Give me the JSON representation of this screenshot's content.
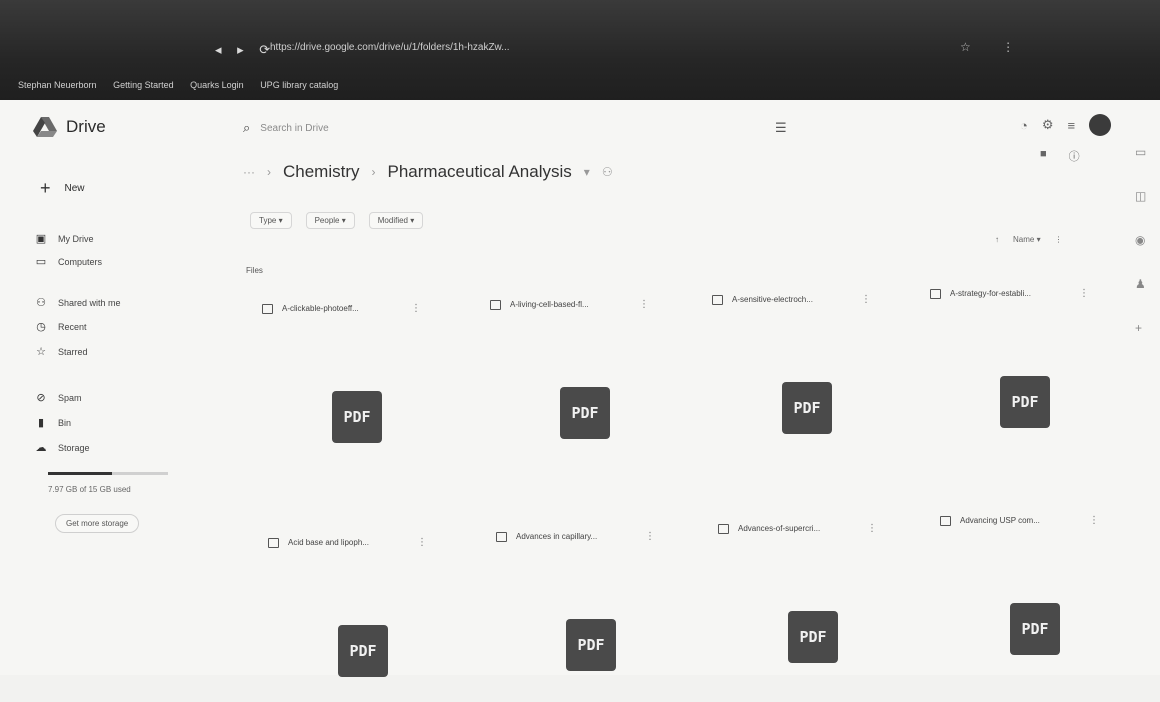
{
  "browser": {
    "url": "https://drive.google.com/drive/u/1/folders/1h-hzakZw...",
    "bookmarks": [
      "Stephan Neuerborn",
      "Getting Started",
      "Quarks Login",
      "UPG library catalog"
    ]
  },
  "app": {
    "name": "Drive"
  },
  "search": {
    "placeholder": "Search in Drive"
  },
  "sidebar": {
    "new_label": "New",
    "items": [
      {
        "label": "My Drive",
        "icon": "drive-icon"
      },
      {
        "label": "Computers",
        "icon": "computer-icon"
      },
      {
        "label": "Shared with me",
        "icon": "people-icon"
      },
      {
        "label": "Recent",
        "icon": "clock-icon"
      },
      {
        "label": "Starred",
        "icon": "star-icon"
      },
      {
        "label": "Spam",
        "icon": "spam-icon"
      },
      {
        "label": "Bin",
        "icon": "trash-icon"
      },
      {
        "label": "Storage",
        "icon": "cloud-icon"
      }
    ],
    "storage_text": "7.97 GB of 15 GB used",
    "storage_fraction": 0.53,
    "storage_button": "Get more storage"
  },
  "breadcrumb": {
    "more": "···",
    "parent": "Chemistry",
    "current": "Pharmaceutical Analysis"
  },
  "filters": [
    "Type",
    "People",
    "Modified"
  ],
  "sort_label": "Name",
  "files_label": "Files",
  "files": [
    {
      "name": "A-clickable-photoeff...",
      "type": "PDF"
    },
    {
      "name": "A-living-cell-based-fl...",
      "type": "PDF"
    },
    {
      "name": "A-sensitive-electroch...",
      "type": "PDF"
    },
    {
      "name": "A-strategy-for-establi...",
      "type": "PDF"
    },
    {
      "name": "Acid base and lipoph...",
      "type": "PDF"
    },
    {
      "name": "Advances in capillary...",
      "type": "PDF"
    },
    {
      "name": "Advances-of-supercri...",
      "type": "PDF"
    },
    {
      "name": "Advancing USP com...",
      "type": "PDF"
    }
  ]
}
